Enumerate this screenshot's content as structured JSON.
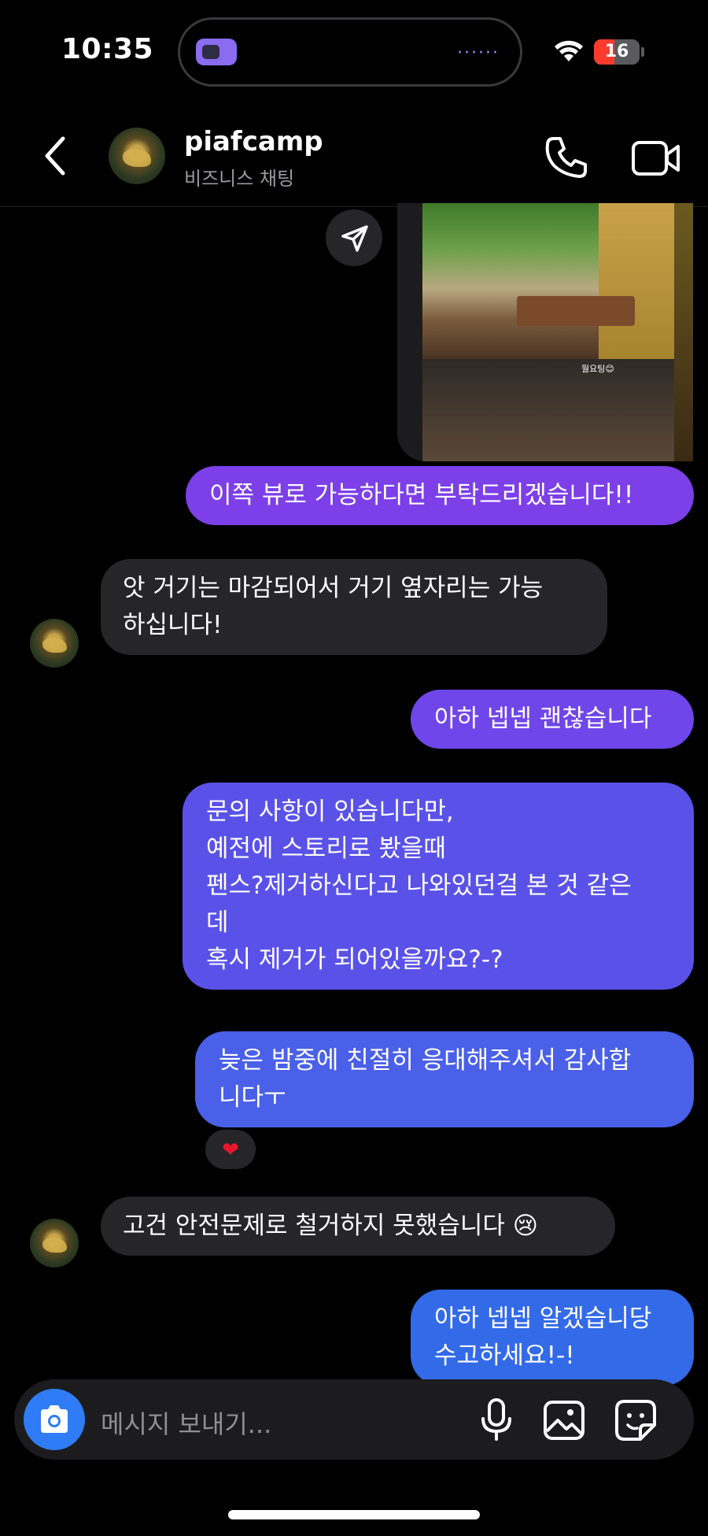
{
  "status_bar": {
    "time": "10:35",
    "battery": "16"
  },
  "header": {
    "name": "piafcamp",
    "subtitle": "비즈니스 채팅"
  },
  "shared_post": {
    "caption_tag": "월요팅😊"
  },
  "messages": [
    {
      "text": "이쪽 뷰로 가능하다면 부탁드리겠습니다!!"
    },
    {
      "text": "앗 거기는 마감되어서 거기 옆자리는 가능\n하십니다!"
    },
    {
      "text": "아하 넵넵 괜찮습니다"
    },
    {
      "text": "문의 사항이 있습니다만,\n예전에 스토리로 봤을때\n펜스?제거하신다고 나와있던걸 본 것 같은\n데\n혹시 제거가 되어있을까요?-?"
    },
    {
      "text": "늦은 밤중에 친절히 응대해주셔서 감사합\n니다ㅜ",
      "reaction": "❤"
    },
    {
      "text": "고건 안전문제로 철거하지 못했습니다 😢"
    },
    {
      "text": "아하 넵넵 알겠습니당\n수고하세요!-!"
    }
  ],
  "composer": {
    "placeholder": "메시지 보내기..."
  },
  "colors": {
    "outgoing_top": "#8b3fe6",
    "outgoing_bottom": "#2f6ce8",
    "incoming": "#262628",
    "camera": "#2f7cf6"
  },
  "icons": [
    "back-icon",
    "phone-icon",
    "video-icon",
    "share-icon",
    "camera-icon",
    "mic-icon",
    "gallery-icon",
    "sticker-icon",
    "wifi-icon"
  ]
}
